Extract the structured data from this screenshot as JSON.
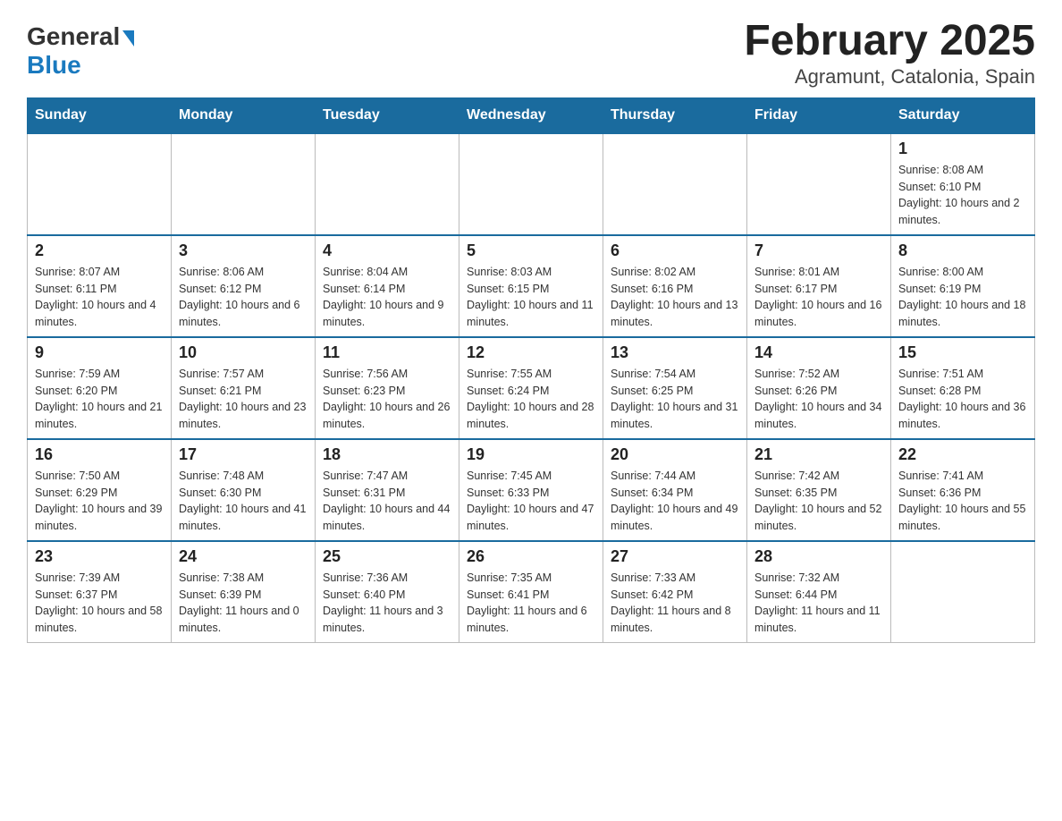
{
  "header": {
    "logo_general": "General",
    "logo_blue": "Blue",
    "title": "February 2025",
    "subtitle": "Agramunt, Catalonia, Spain"
  },
  "days_of_week": [
    "Sunday",
    "Monday",
    "Tuesday",
    "Wednesday",
    "Thursday",
    "Friday",
    "Saturday"
  ],
  "weeks": [
    [
      {
        "day": "",
        "info": ""
      },
      {
        "day": "",
        "info": ""
      },
      {
        "day": "",
        "info": ""
      },
      {
        "day": "",
        "info": ""
      },
      {
        "day": "",
        "info": ""
      },
      {
        "day": "",
        "info": ""
      },
      {
        "day": "1",
        "info": "Sunrise: 8:08 AM\nSunset: 6:10 PM\nDaylight: 10 hours and 2 minutes."
      }
    ],
    [
      {
        "day": "2",
        "info": "Sunrise: 8:07 AM\nSunset: 6:11 PM\nDaylight: 10 hours and 4 minutes."
      },
      {
        "day": "3",
        "info": "Sunrise: 8:06 AM\nSunset: 6:12 PM\nDaylight: 10 hours and 6 minutes."
      },
      {
        "day": "4",
        "info": "Sunrise: 8:04 AM\nSunset: 6:14 PM\nDaylight: 10 hours and 9 minutes."
      },
      {
        "day": "5",
        "info": "Sunrise: 8:03 AM\nSunset: 6:15 PM\nDaylight: 10 hours and 11 minutes."
      },
      {
        "day": "6",
        "info": "Sunrise: 8:02 AM\nSunset: 6:16 PM\nDaylight: 10 hours and 13 minutes."
      },
      {
        "day": "7",
        "info": "Sunrise: 8:01 AM\nSunset: 6:17 PM\nDaylight: 10 hours and 16 minutes."
      },
      {
        "day": "8",
        "info": "Sunrise: 8:00 AM\nSunset: 6:19 PM\nDaylight: 10 hours and 18 minutes."
      }
    ],
    [
      {
        "day": "9",
        "info": "Sunrise: 7:59 AM\nSunset: 6:20 PM\nDaylight: 10 hours and 21 minutes."
      },
      {
        "day": "10",
        "info": "Sunrise: 7:57 AM\nSunset: 6:21 PM\nDaylight: 10 hours and 23 minutes."
      },
      {
        "day": "11",
        "info": "Sunrise: 7:56 AM\nSunset: 6:23 PM\nDaylight: 10 hours and 26 minutes."
      },
      {
        "day": "12",
        "info": "Sunrise: 7:55 AM\nSunset: 6:24 PM\nDaylight: 10 hours and 28 minutes."
      },
      {
        "day": "13",
        "info": "Sunrise: 7:54 AM\nSunset: 6:25 PM\nDaylight: 10 hours and 31 minutes."
      },
      {
        "day": "14",
        "info": "Sunrise: 7:52 AM\nSunset: 6:26 PM\nDaylight: 10 hours and 34 minutes."
      },
      {
        "day": "15",
        "info": "Sunrise: 7:51 AM\nSunset: 6:28 PM\nDaylight: 10 hours and 36 minutes."
      }
    ],
    [
      {
        "day": "16",
        "info": "Sunrise: 7:50 AM\nSunset: 6:29 PM\nDaylight: 10 hours and 39 minutes."
      },
      {
        "day": "17",
        "info": "Sunrise: 7:48 AM\nSunset: 6:30 PM\nDaylight: 10 hours and 41 minutes."
      },
      {
        "day": "18",
        "info": "Sunrise: 7:47 AM\nSunset: 6:31 PM\nDaylight: 10 hours and 44 minutes."
      },
      {
        "day": "19",
        "info": "Sunrise: 7:45 AM\nSunset: 6:33 PM\nDaylight: 10 hours and 47 minutes."
      },
      {
        "day": "20",
        "info": "Sunrise: 7:44 AM\nSunset: 6:34 PM\nDaylight: 10 hours and 49 minutes."
      },
      {
        "day": "21",
        "info": "Sunrise: 7:42 AM\nSunset: 6:35 PM\nDaylight: 10 hours and 52 minutes."
      },
      {
        "day": "22",
        "info": "Sunrise: 7:41 AM\nSunset: 6:36 PM\nDaylight: 10 hours and 55 minutes."
      }
    ],
    [
      {
        "day": "23",
        "info": "Sunrise: 7:39 AM\nSunset: 6:37 PM\nDaylight: 10 hours and 58 minutes."
      },
      {
        "day": "24",
        "info": "Sunrise: 7:38 AM\nSunset: 6:39 PM\nDaylight: 11 hours and 0 minutes."
      },
      {
        "day": "25",
        "info": "Sunrise: 7:36 AM\nSunset: 6:40 PM\nDaylight: 11 hours and 3 minutes."
      },
      {
        "day": "26",
        "info": "Sunrise: 7:35 AM\nSunset: 6:41 PM\nDaylight: 11 hours and 6 minutes."
      },
      {
        "day": "27",
        "info": "Sunrise: 7:33 AM\nSunset: 6:42 PM\nDaylight: 11 hours and 8 minutes."
      },
      {
        "day": "28",
        "info": "Sunrise: 7:32 AM\nSunset: 6:44 PM\nDaylight: 11 hours and 11 minutes."
      },
      {
        "day": "",
        "info": ""
      }
    ]
  ]
}
